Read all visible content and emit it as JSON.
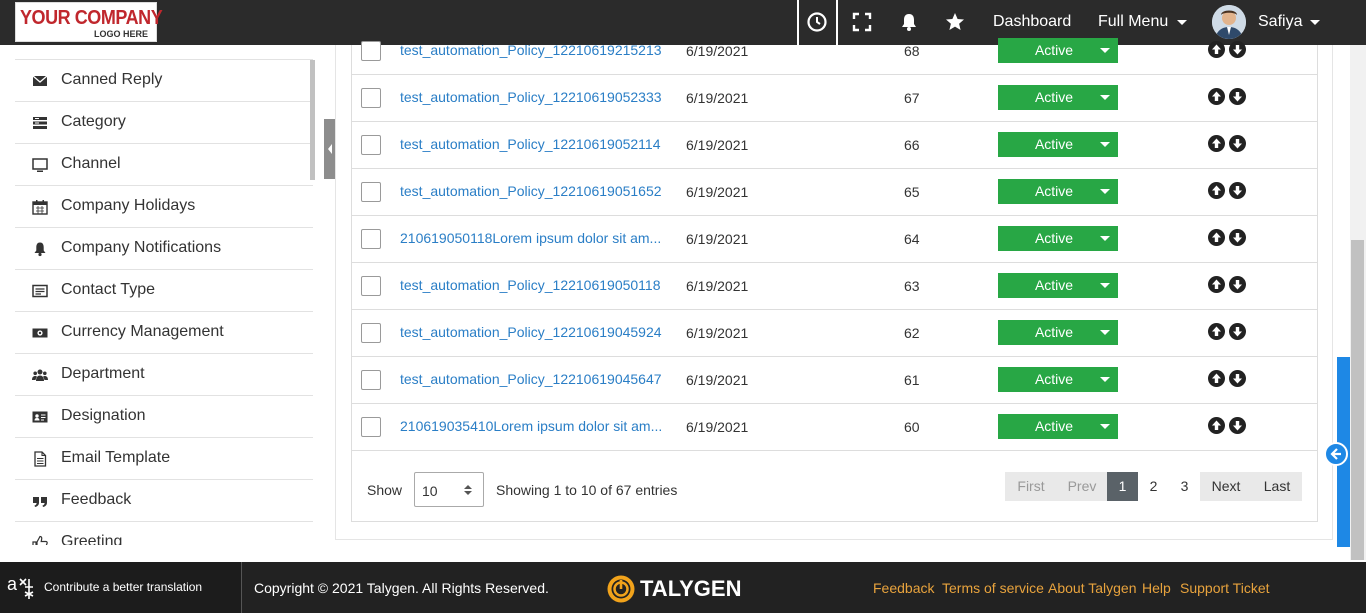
{
  "header": {
    "logo_line1": "YOUR COMPANY",
    "logo_line2": "LOGO HERE",
    "nav_dashboard": "Dashboard",
    "nav_full_menu": "Full Menu",
    "user_name": "Safiya",
    "icons": [
      "clock-icon",
      "fullscreen-icon",
      "bell-icon",
      "star-icon"
    ]
  },
  "sidebar": {
    "items": [
      {
        "label": "Canned Reply",
        "icon": "envelope-icon"
      },
      {
        "label": "Category",
        "icon": "category-icon"
      },
      {
        "label": "Channel",
        "icon": "monitor-icon"
      },
      {
        "label": "Company Holidays",
        "icon": "calendar-icon"
      },
      {
        "label": "Company Notifications",
        "icon": "bell-icon"
      },
      {
        "label": "Contact Type",
        "icon": "card-list-icon"
      },
      {
        "label": "Currency Management",
        "icon": "money-icon"
      },
      {
        "label": "Department",
        "icon": "users-icon"
      },
      {
        "label": "Designation",
        "icon": "id-card-icon"
      },
      {
        "label": "Email Template",
        "icon": "file-icon"
      },
      {
        "label": "Feedback",
        "icon": "quote-icon"
      },
      {
        "label": "Greeting",
        "icon": "thumbs-up-icon"
      }
    ]
  },
  "table": {
    "rows": [
      {
        "name": "test_automation_Policy_12210619215213",
        "date": "6/19/2021",
        "order": "68",
        "status": "Active"
      },
      {
        "name": "test_automation_Policy_12210619052333",
        "date": "6/19/2021",
        "order": "67",
        "status": "Active"
      },
      {
        "name": "test_automation_Policy_12210619052114",
        "date": "6/19/2021",
        "order": "66",
        "status": "Active"
      },
      {
        "name": "test_automation_Policy_12210619051652",
        "date": "6/19/2021",
        "order": "65",
        "status": "Active"
      },
      {
        "name": "210619050118Lorem ipsum dolor sit am...",
        "date": "6/19/2021",
        "order": "64",
        "status": "Active"
      },
      {
        "name": "test_automation_Policy_12210619050118",
        "date": "6/19/2021",
        "order": "63",
        "status": "Active"
      },
      {
        "name": "test_automation_Policy_12210619045924",
        "date": "6/19/2021",
        "order": "62",
        "status": "Active"
      },
      {
        "name": "test_automation_Policy_12210619045647",
        "date": "6/19/2021",
        "order": "61",
        "status": "Active"
      },
      {
        "name": "210619035410Lorem ipsum dolor sit am...",
        "date": "6/19/2021",
        "order": "60",
        "status": "Active"
      }
    ],
    "show_label": "Show",
    "page_size": "10",
    "showing_text": "Showing 1 to 10 of 67 entries",
    "pagination": {
      "first": "First",
      "prev": "Prev",
      "pages": [
        "1",
        "2",
        "3"
      ],
      "current": "1",
      "next": "Next",
      "last": "Last"
    }
  },
  "footer": {
    "translate_text": "Contribute a better translation",
    "copyright": "Copyright © 2021 Talygen. All Rights Reserved.",
    "brand": "TALYGEN",
    "links": [
      "Feedback",
      "Terms of service",
      "About Talygen",
      "Help",
      "Support Ticket"
    ]
  },
  "colors": {
    "topbar": "#2b2b2b",
    "link": "#2a7ec6",
    "status_active": "#28a745",
    "pager_active": "#5a6268",
    "footer_link": "#e8a33d",
    "accent_blue": "#1e88e5"
  }
}
